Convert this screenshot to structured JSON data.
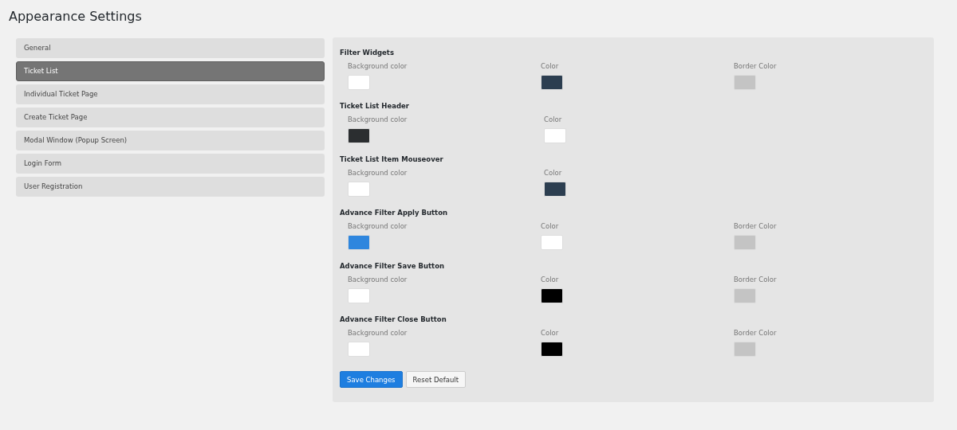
{
  "page_title": "Appearance Settings",
  "sidebar": {
    "items": [
      {
        "label": "General",
        "selected": false
      },
      {
        "label": "Ticket List",
        "selected": true
      },
      {
        "label": "Individual Ticket Page",
        "selected": false
      },
      {
        "label": "Create Ticket Page",
        "selected": false
      },
      {
        "label": "Modal Window (Popup Screen)",
        "selected": false
      },
      {
        "label": "Login Form",
        "selected": false
      },
      {
        "label": "User Registration",
        "selected": false
      }
    ]
  },
  "sections": [
    {
      "title": "Filter Widgets",
      "fields": [
        {
          "label": "Background color",
          "color": "#ffffff"
        },
        {
          "label": "Color",
          "color": "#2c3e50"
        },
        {
          "label": "Border Color",
          "color": "#c4c4c4"
        }
      ]
    },
    {
      "title": "Ticket List Header",
      "fields": [
        {
          "label": "Background color",
          "color": "#2b2e30"
        },
        {
          "label": "Color",
          "color": "#ffffff"
        }
      ]
    },
    {
      "title": "Ticket List Item Mouseover",
      "fields": [
        {
          "label": "Background color",
          "color": "#ffffff"
        },
        {
          "label": "Color",
          "color": "#2c3e50"
        }
      ]
    },
    {
      "title": "Advance Filter Apply Button",
      "fields": [
        {
          "label": "Background color",
          "color": "#2e86de"
        },
        {
          "label": "Color",
          "color": "#ffffff"
        },
        {
          "label": "Border Color",
          "color": "#c4c4c4"
        }
      ]
    },
    {
      "title": "Advance Filter Save Button",
      "fields": [
        {
          "label": "Background color",
          "color": "#ffffff"
        },
        {
          "label": "Color",
          "color": "#000000"
        },
        {
          "label": "Border Color",
          "color": "#c4c4c4"
        }
      ]
    },
    {
      "title": "Advance Filter Close Button",
      "fields": [
        {
          "label": "Background color",
          "color": "#ffffff"
        },
        {
          "label": "Color",
          "color": "#000000"
        },
        {
          "label": "Border Color",
          "color": "#c4c4c4"
        }
      ]
    }
  ],
  "buttons": [
    {
      "label": "Save Changes",
      "kind": "primary"
    },
    {
      "label": "Reset Default",
      "kind": "secondary"
    }
  ]
}
